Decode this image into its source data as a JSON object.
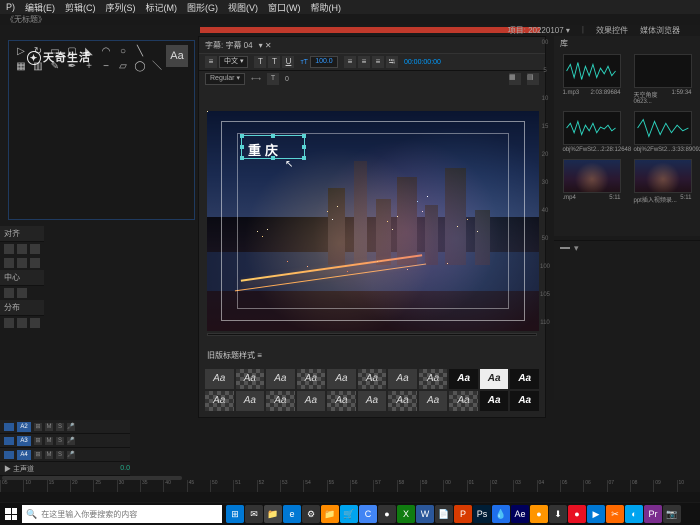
{
  "menu": {
    "items": [
      "P)",
      "编辑(E)",
      "剪辑(C)",
      "序列(S)",
      "标记(M)",
      "图形(G)",
      "视图(V)",
      "窗口(W)",
      "帮助(H)"
    ]
  },
  "titlebar": {
    "text": "《无标题》"
  },
  "workspace": {
    "project_label": "项目",
    "project_name": "20220107",
    "effects": "效果控件",
    "browse": "媒体浏览器"
  },
  "tools": {
    "aa": "Aa"
  },
  "watermark": {
    "text": "天奇生活"
  },
  "align": {
    "hdr1": "对齐",
    "hdr2": "中心",
    "hdr3": "分布"
  },
  "eg": {
    "tab": "字幕: 字幕 04",
    "font_sel": "中文",
    "size": "100.0",
    "tc": "00:00:00:00",
    "weight": "Regular",
    "tracking": "0",
    "title_text": "重庆",
    "styles_hdr": "旧版标题样式",
    "style": "Aa"
  },
  "project": {
    "tab": "库",
    "items": [
      {
        "name": "1.mp3",
        "dur": "2:03:89684"
      },
      {
        "name": "天空角度0623...",
        "dur": "1:59:34"
      },
      {
        "name": "obj%2FwSt2...",
        "dur": "2:28:12648"
      },
      {
        "name": "obj%2FwSt2...",
        "dur": "3:33:89092"
      },
      {
        "name": ".mp4",
        "dur": "5:11"
      },
      {
        "name": "ppt插入视频录...",
        "dur": "5:11"
      }
    ]
  },
  "vmarks": [
    "00",
    "5",
    "10",
    "15",
    "20",
    "30",
    "40",
    "50",
    "100",
    "105",
    "110"
  ],
  "timeline": {
    "tracks": [
      {
        "tag": "A2",
        "icons": [
          "⊞",
          "M",
          "S",
          "🎤"
        ]
      },
      {
        "tag": "A3",
        "icons": [
          "⊞",
          "M",
          "S",
          "🎤"
        ]
      },
      {
        "tag": "A4",
        "icons": [
          "⊞",
          "M",
          "S",
          "🎤"
        ]
      }
    ],
    "master": "▶ 主声道",
    "master_val": "0.0",
    "ruler": [
      "05",
      "10",
      "15",
      "20",
      "25",
      "30",
      "35",
      "40",
      "45",
      "50",
      "51",
      "52",
      "53",
      "54",
      "55",
      "56",
      "57",
      "58",
      "59",
      "00",
      "01",
      "02",
      "03",
      "04",
      "05",
      "06",
      "07",
      "08",
      "09",
      "10"
    ]
  },
  "taskbar": {
    "search_placeholder": "在这里输入你要搜索的内容",
    "apps": [
      {
        "c": "#0078d4",
        "t": "⊞"
      },
      {
        "c": "#333",
        "t": "✉"
      },
      {
        "c": "#444",
        "t": "📁"
      },
      {
        "c": "#0078d4",
        "t": "e"
      },
      {
        "c": "#333",
        "t": "⚙"
      },
      {
        "c": "#ff8c00",
        "t": "📁"
      },
      {
        "c": "#00a4ef",
        "t": "🛒"
      },
      {
        "c": "#4285f4",
        "t": "C"
      },
      {
        "c": "#333",
        "t": "●"
      },
      {
        "c": "#107c10",
        "t": "X"
      },
      {
        "c": "#2b579a",
        "t": "W"
      },
      {
        "c": "#333",
        "t": "📄"
      },
      {
        "c": "#d83b01",
        "t": "P"
      },
      {
        "c": "#001e36",
        "t": "Ps"
      },
      {
        "c": "#1f6feb",
        "t": "💧"
      },
      {
        "c": "#00005b",
        "t": "Ae"
      },
      {
        "c": "#ff9500",
        "t": "●"
      },
      {
        "c": "#333",
        "t": "⬇"
      },
      {
        "c": "#e81123",
        "t": "●"
      },
      {
        "c": "#0078d4",
        "t": "▶"
      },
      {
        "c": "#ff6a00",
        "t": "✂"
      },
      {
        "c": "#00a4ef",
        "t": "◐"
      },
      {
        "c": "#7b2d8e",
        "t": "Pr"
      },
      {
        "c": "#333",
        "t": "📷"
      }
    ]
  }
}
